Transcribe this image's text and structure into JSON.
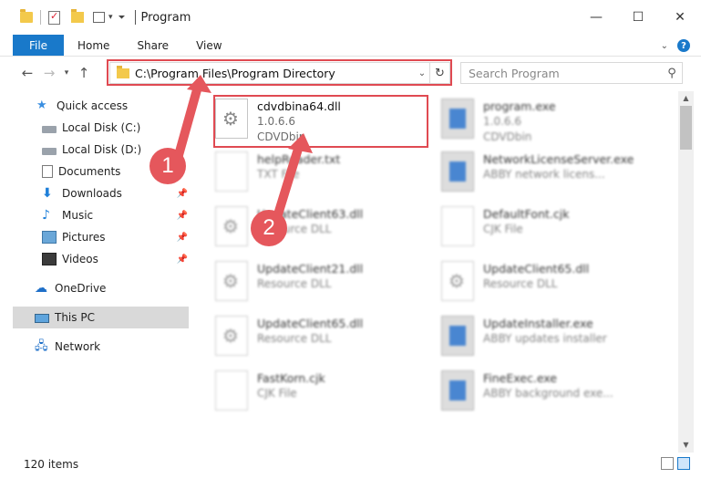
{
  "window": {
    "title": "Program",
    "minimize_glyph": "—",
    "maximize_glyph": "☐",
    "close_glyph": "✕"
  },
  "ribbon": {
    "file": "File",
    "tabs": [
      "Home",
      "Share",
      "View"
    ]
  },
  "nav": {
    "back_glyph": "←",
    "forward_glyph": "→",
    "recent_glyph": "▾",
    "up_glyph": "↑"
  },
  "address": {
    "path": "C:\\Program Files\\Program Directory",
    "dropdown_glyph": "⌄",
    "refresh_glyph": "↻"
  },
  "search": {
    "placeholder": "Search Program",
    "icon": "search-icon"
  },
  "sidebar": {
    "items": [
      {
        "label": "Quick access",
        "icon": "star-icon",
        "pinned": false
      },
      {
        "label": "Local Disk (C:)",
        "icon": "drive-icon",
        "pinned": false
      },
      {
        "label": "Local Disk (D:)",
        "icon": "drive-icon",
        "pinned": false
      },
      {
        "label": "Documents",
        "icon": "documents-icon",
        "pinned": false
      },
      {
        "label": "Downloads",
        "icon": "download-icon",
        "pinned": true
      },
      {
        "label": "Music",
        "icon": "music-icon",
        "pinned": true
      },
      {
        "label": "Pictures",
        "icon": "pictures-icon",
        "pinned": true
      },
      {
        "label": "Videos",
        "icon": "videos-icon",
        "pinned": true
      },
      {
        "label": "OneDrive",
        "icon": "cloud-icon",
        "pinned": false
      },
      {
        "label": "This PC",
        "icon": "computer-icon",
        "pinned": false,
        "selected": true
      },
      {
        "label": "Network",
        "icon": "network-icon",
        "pinned": false
      }
    ]
  },
  "files": [
    {
      "name": "cdvdbina64.dll",
      "line2": "1.0.6.6",
      "line3": "CDVDbin",
      "icon": "dll-file-icon"
    },
    {
      "name": "program.exe",
      "line2": "1.0.6.6",
      "line3": "CDVDbin",
      "icon": "exe-file-icon"
    },
    {
      "name": "helpReader.txt",
      "line2": "TXT File",
      "icon": "text-file-icon"
    },
    {
      "name": "NetworkLicenseServer.exe",
      "line2": "ABBY network licens...",
      "icon": "exe-file-icon"
    },
    {
      "name": "UpdateClient63.dll",
      "line2": "Resource DLL",
      "icon": "dll-file-icon"
    },
    {
      "name": "DefaultFont.cjk",
      "line2": "CJK File",
      "icon": "generic-file-icon"
    },
    {
      "name": "UpdateClient21.dll",
      "line2": "Resource DLL",
      "icon": "dll-file-icon"
    },
    {
      "name": "UpdateClient65.dll",
      "line2": "Resource DLL",
      "icon": "dll-file-icon"
    },
    {
      "name": "UpdateClient65.dll",
      "line2": "Resource DLL",
      "icon": "dll-file-icon"
    },
    {
      "name": "UpdateInstaller.exe",
      "line2": "ABBY updates installer",
      "icon": "exe-file-icon"
    },
    {
      "name": "FastKorn.cjk",
      "line2": "CJK File",
      "icon": "generic-file-icon"
    },
    {
      "name": "FineExec.exe",
      "line2": "ABBY background exe...",
      "icon": "exe-file-icon"
    }
  ],
  "status": {
    "items_count": "120 items"
  },
  "annotations": {
    "badge1": "1",
    "badge2": "2",
    "highlight_color": "#e04a52"
  }
}
